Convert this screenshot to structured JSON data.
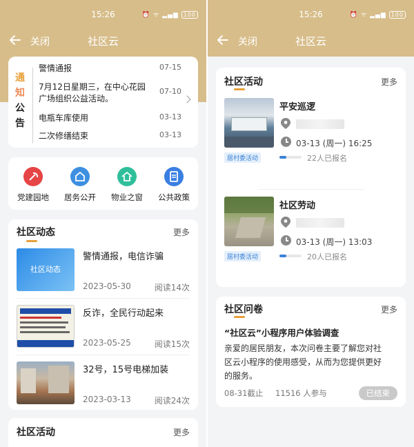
{
  "status_bar": {
    "time": "15:26",
    "battery": "100"
  },
  "nav": {
    "close": "关闭",
    "title": "社区云"
  },
  "notices": {
    "tag": [
      "通",
      "知",
      "公",
      "告"
    ],
    "items": [
      {
        "text": "警情通报",
        "date": "07-15"
      },
      {
        "text": "7月12日星期三，在中心花园",
        "text2": "广场组织公益活动。",
        "date": "07-10"
      },
      {
        "text": "电瓶车库使用",
        "date": "03-13"
      },
      {
        "text": "二次修缮结束",
        "date": "03-13"
      }
    ]
  },
  "services": [
    {
      "label": "党建园地",
      "icon": "party-building-icon",
      "color": "#e64545"
    },
    {
      "label": "居务公开",
      "icon": "residence-affairs-icon",
      "color": "#3d8fe0"
    },
    {
      "label": "物业之窗",
      "icon": "property-window-icon",
      "color": "#2fbf9a"
    },
    {
      "label": "公共政策",
      "icon": "public-policy-icon",
      "color": "#3a7fe2"
    }
  ],
  "news": {
    "title": "社区动态",
    "more": "更多",
    "items": [
      {
        "thumb_text": "社区动态",
        "title": "警情通报，电信诈骗",
        "date": "2023-05-30",
        "reads": "阅读14次"
      },
      {
        "title": "反诈，全民行动起来",
        "date": "2023-05-25",
        "reads": "阅读15次"
      },
      {
        "title": "32号，15号电梯加装",
        "date": "2023-03-13",
        "reads": "阅读24次"
      }
    ]
  },
  "activities_stub": {
    "title": "社区活动",
    "more": "更多"
  },
  "activities": {
    "title": "社区活动",
    "more": "更多",
    "items": [
      {
        "title": "平安巡逻",
        "time": "03-13 (周一) 16:25",
        "badge": "居村委活动",
        "count": "22人已报名",
        "progress": 0.3
      },
      {
        "title": "社区劳动",
        "time": "03-13 (周一) 13:03",
        "badge": "居村委活动",
        "count": "20人已报名",
        "progress": 0.3
      }
    ]
  },
  "survey": {
    "title": "社区问卷",
    "more": "更多",
    "name": "“社区云”小程序用户体验调查",
    "desc1": "亲爱的居民朋友，本次问卷主要了解您对社",
    "desc2": "区云小程序的使用感受，从而为您提供更好",
    "desc3": "的服务。",
    "deadline": "08-31截止",
    "participants": "11516 人参与",
    "status": "已结束"
  },
  "colors": {
    "header": "#d7bd8a",
    "accent": "#e8a03a",
    "badge": "#3a82d6"
  }
}
